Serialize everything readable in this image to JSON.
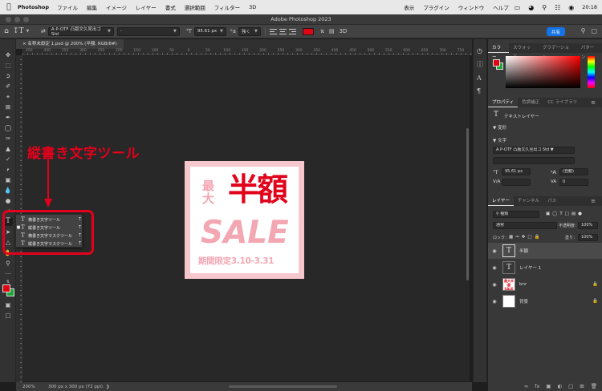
{
  "menubar": {
    "app_name": "Photoshop",
    "items": [
      "ファイル",
      "編集",
      "イメージ",
      "レイヤー",
      "書式",
      "選択範囲",
      "フィルター",
      "3D",
      "表示",
      "プラグイン",
      "ウィンドウ",
      "ヘルプ"
    ],
    "time": "20:18"
  },
  "titlebar": {
    "title": "Adobe Photoshop 2023"
  },
  "options": {
    "font_family": "A P-OTF 凸版文久見出ゴ Std",
    "font_style": "-",
    "font_size": "95.61 px",
    "antialias": "強く",
    "mode_3d": "3D",
    "share_label": "共有",
    "text_color": "#e00512"
  },
  "document": {
    "tab_title": "名称未設定 1.psd @ 200% (半額, RGB/8#)",
    "ruler_labels": [
      "450",
      "400",
      "350",
      "300",
      "250",
      "200",
      "150",
      "100",
      "50",
      "0",
      "50",
      "100",
      "150",
      "200",
      "250",
      "300",
      "350",
      "400",
      "450",
      "500",
      "550",
      "600",
      "650",
      "700",
      "750"
    ],
    "zoom": "200%",
    "dimensions": "300 px x 300 px (72 ppi)"
  },
  "banner": {
    "saidai": "最大",
    "hangaku": "半額",
    "sale": "SALE",
    "period": "期間限定3.10-3.31"
  },
  "annotation": {
    "label": "縦書き文字ツール"
  },
  "flyout": {
    "items": [
      {
        "label": "横書き文字ツール",
        "key": "T",
        "selected": false
      },
      {
        "label": "縦書き文字ツール",
        "key": "T",
        "selected": true
      },
      {
        "label": "横書き文字マスクツール",
        "key": "T",
        "selected": false
      },
      {
        "label": "縦書き文字マスクツール",
        "key": "T",
        "selected": false
      }
    ]
  },
  "color_panel": {
    "tabs": [
      "カラー",
      "スウォッチ",
      "グラデーション",
      "パターン"
    ],
    "foreground": "#e00512",
    "background": "#1ea63a"
  },
  "properties_panel": {
    "tabs": [
      "プロパティ",
      "色調補正",
      "CC ライブラリ"
    ],
    "layer_kind": "テキストレイヤー",
    "transform_label": "変形",
    "text_label": "文字",
    "font_family": "A P-OTF 凸版文久見出ゴ Std",
    "font_size": "95.61 px",
    "leading": "(自動)",
    "tracking": "0"
  },
  "layers_panel": {
    "tabs": [
      "レイヤー",
      "チャンネル",
      "パス"
    ],
    "filter_label": "種類",
    "blend_mode": "通常",
    "opacity_label": "不透明度：",
    "opacity_value": "100%",
    "lock_label": "ロック：",
    "fill_label": "塗り：",
    "fill_value": "100%",
    "layers": [
      {
        "name": "半額",
        "kind": "text",
        "selected": true,
        "locked": false
      },
      {
        "name": "レイヤー 1",
        "kind": "text",
        "selected": false,
        "locked": false
      },
      {
        "name": "bnr",
        "kind": "image",
        "selected": false,
        "locked": true,
        "thumb_text": "最大半額SALE"
      },
      {
        "name": "背景",
        "kind": "background",
        "selected": false,
        "locked": true
      }
    ]
  }
}
